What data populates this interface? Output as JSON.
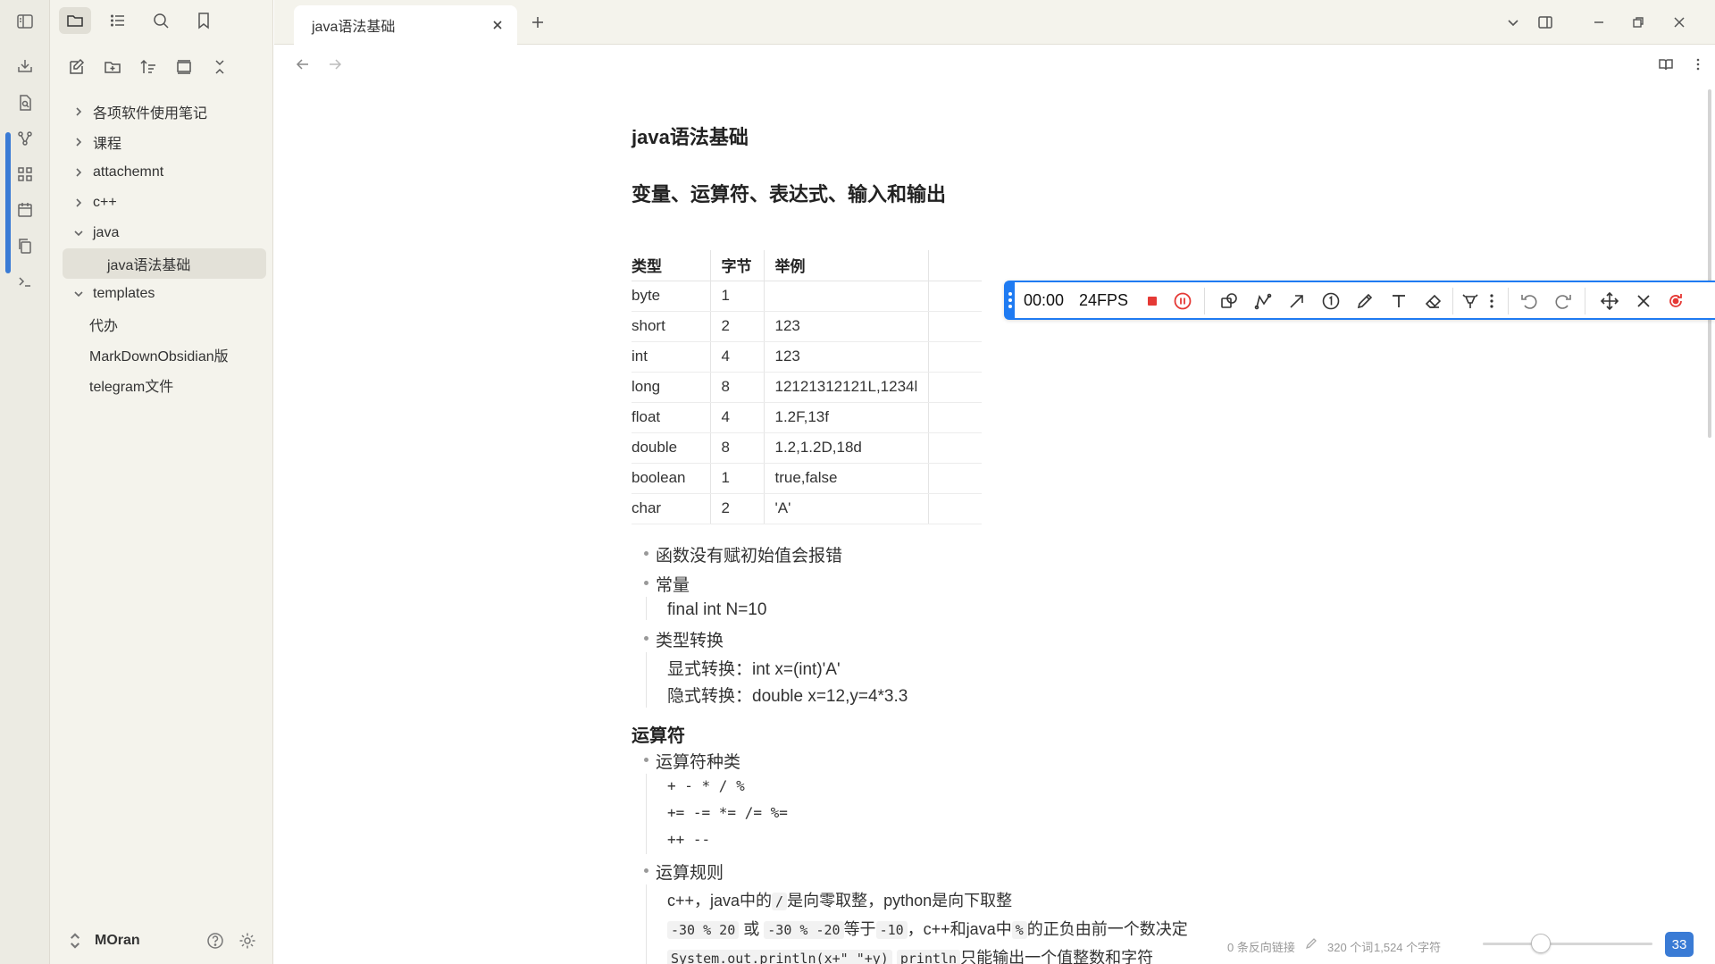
{
  "app": {
    "tab_title": "java语法基础",
    "vault_name": "MOran"
  },
  "sidebar": {
    "items": [
      {
        "label": "各项软件使用笔记"
      },
      {
        "label": "课程"
      },
      {
        "label": "attachemnt"
      },
      {
        "label": "c++"
      },
      {
        "label": "java"
      },
      {
        "label": "java语法基础"
      },
      {
        "label": "templates"
      },
      {
        "label": "代办"
      },
      {
        "label": "MarkDownObsidian版"
      },
      {
        "label": "telegram文件"
      }
    ]
  },
  "doc": {
    "title": "java语法基础",
    "section1": "变量、运算符、表达式、输入和输出",
    "table": {
      "headers": [
        "类型",
        "字节",
        "举例"
      ],
      "rows": [
        [
          "byte",
          "1",
          ""
        ],
        [
          "short",
          "2",
          "123"
        ],
        [
          "int",
          "4",
          "123"
        ],
        [
          "long",
          "8",
          "12121312121L,1234l"
        ],
        [
          "float",
          "4",
          "1.2F,13f"
        ],
        [
          "double",
          "8",
          "1.2,1.2D,18d"
        ],
        [
          "boolean",
          "1",
          "true,false"
        ],
        [
          "char",
          "2",
          "'A'"
        ]
      ]
    },
    "bullets1": [
      "函数没有赋初始值会报错",
      "常量",
      "类型转换"
    ],
    "const_line": "final int N=10",
    "cast_explicit": "显式转换：int x=(int)'A'",
    "cast_implicit": "隐式转换：double x=12,y=4*3.3",
    "section2": "运算符",
    "op_kinds": "运算符种类",
    "ops_line1": "+ - * / %",
    "ops_line2": "+= -= *=  /= %=",
    "ops_line3": "++ --",
    "op_rules": "运算规则",
    "rule_line1_a": "c++，java中的",
    "rule_line1_code": "/",
    "rule_line1_b": "是向零取整，python是向下取整",
    "rule_line2_code1": "-30 % 20",
    "rule_line2_or": "或",
    "rule_line2_code2": "-30 % -20",
    "rule_line2_eq": "等于",
    "rule_line2_code3": "-10",
    "rule_line2_b": "，c++和java中",
    "rule_line2_code4": "%",
    "rule_line2_c": "的正负由前一个数决定",
    "rule_line3_code1": "System.out.println(x+\" \"+y)",
    "rule_line3_code2": "println",
    "rule_line3_b": "只能输出一个值整数和字符"
  },
  "recorder": {
    "time": "00:00",
    "fps": "24FPS"
  },
  "status": {
    "backlinks": "0 条反向链接",
    "words": "320 个词",
    "chars": "1,524 个字符",
    "zoom": "33"
  }
}
